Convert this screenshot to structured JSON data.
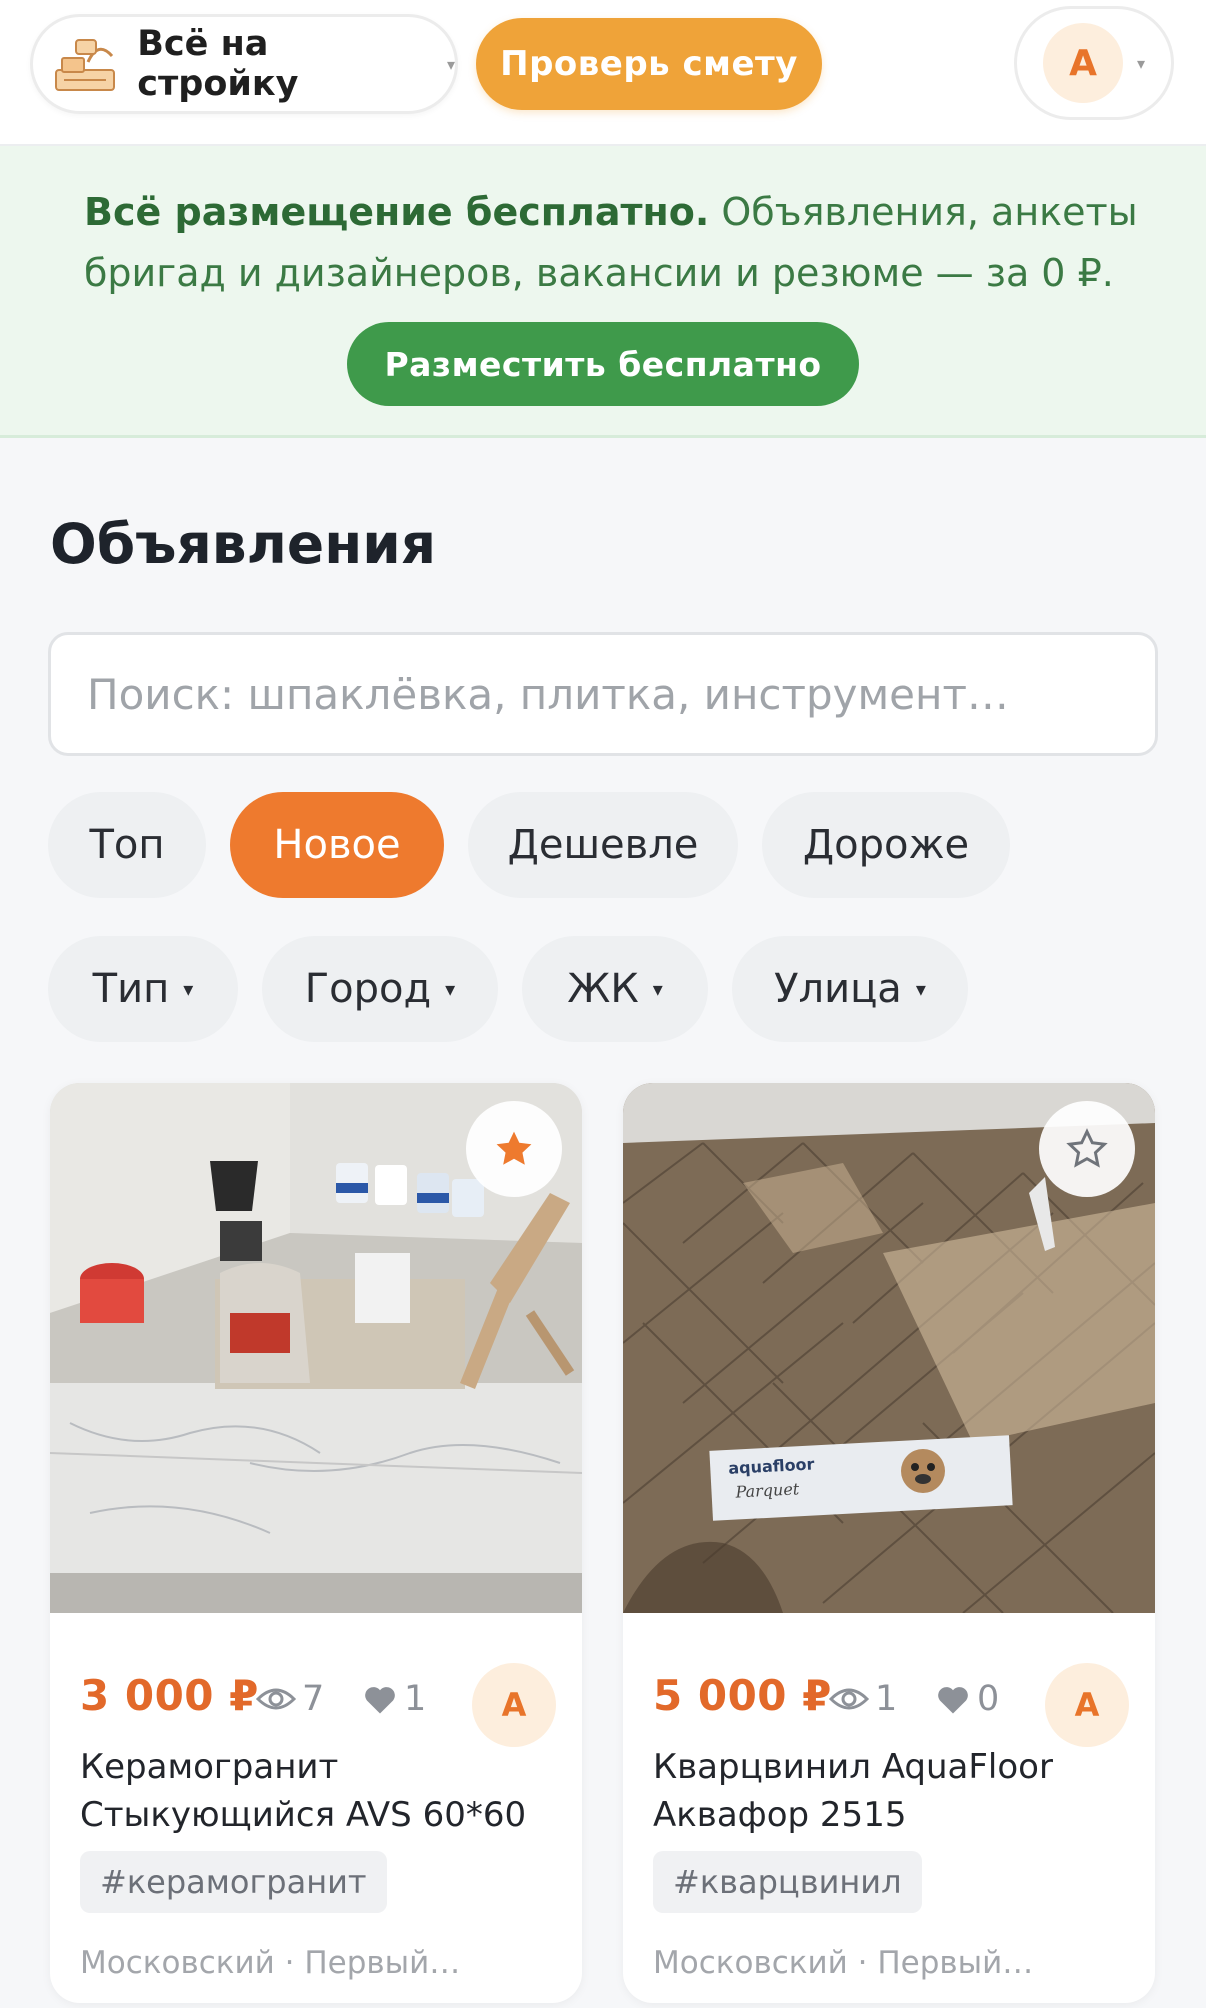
{
  "header": {
    "logo_label": "Всё на стройку",
    "logo_caret": "▾",
    "check_estimate_label": "Проверь смету",
    "user_initial": "А",
    "user_caret": "▾"
  },
  "banner": {
    "bold_text": "Всё размещение бесплатно.",
    "text": " Объявления, анкеты бригад и дизайнеров, вакансии и резюме — за 0 ₽.",
    "button_label": "Разместить бесплатно"
  },
  "listings": {
    "title": "Объявления",
    "search_placeholder": "Поиск: шпаклёвка, плитка, инструмент…",
    "sort_chips": [
      "Топ",
      "Новое",
      "Дешевле",
      "Дороже"
    ],
    "active_sort": "Новое",
    "filter_chips": [
      "Тип",
      "Город",
      "ЖК",
      "Улица"
    ],
    "filter_caret": "▾"
  },
  "cards": [
    {
      "price": "3 000 ₽",
      "views": "7",
      "likes": "1",
      "author_initial": "А",
      "title": "Керамогранит Стыкующийся AVS 60*60",
      "tag": "#керамогранит",
      "location": "Московский · Первый…",
      "favorited": true
    },
    {
      "price": "5 000 ₽",
      "views": "1",
      "likes": "0",
      "author_initial": "А",
      "title": "Кварцвинил AquaFloor Аквафор 2515",
      "tag": "#кварцвинил",
      "location": "Московский · Первый…",
      "favorited": false,
      "box_brand": "aquafloor",
      "box_line": "Parquet"
    }
  ],
  "colors": {
    "accent_orange": "#ee7a2e",
    "estimate_yellow": "#efa339",
    "banner_green": "#3f9a4b",
    "banner_bg": "#edf7ee"
  }
}
